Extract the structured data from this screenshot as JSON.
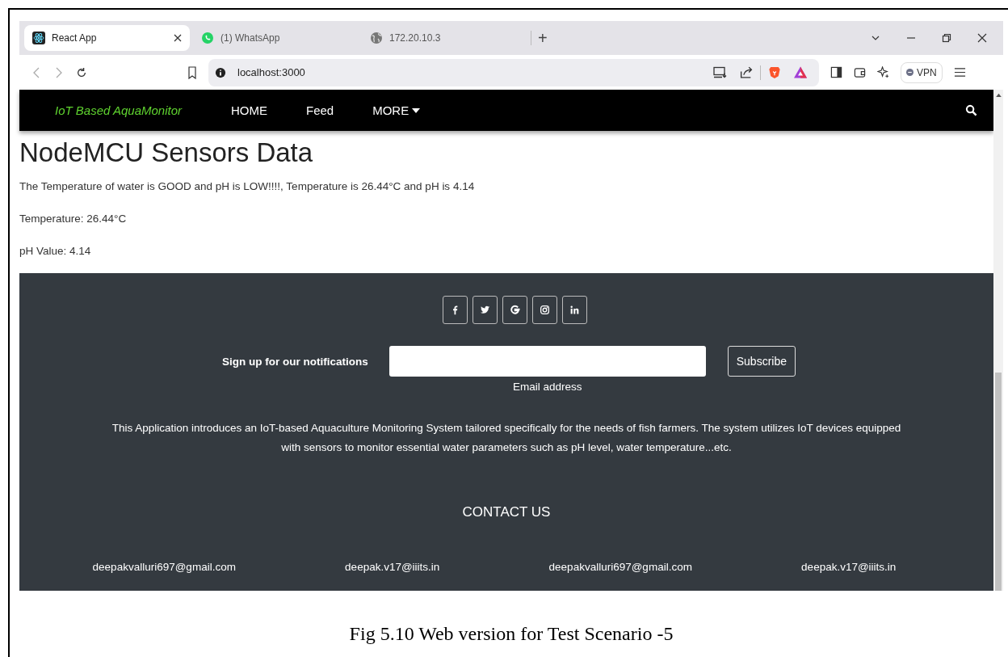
{
  "browser": {
    "tabs": [
      {
        "title": "React App",
        "kind": "react",
        "selected": true
      },
      {
        "title": "(1) WhatsApp",
        "kind": "whatsapp",
        "selected": false
      },
      {
        "title": "172.20.10.3",
        "kind": "globe",
        "selected": false
      }
    ],
    "new_tab": "+",
    "url": "localhost:3000",
    "vpn": "VPN"
  },
  "navbar": {
    "brand": "IoT Based AquaMonitor",
    "links": [
      {
        "label": "HOME",
        "dropdown": false
      },
      {
        "label": "Feed",
        "dropdown": false
      },
      {
        "label": "MORE",
        "dropdown": true
      }
    ]
  },
  "content": {
    "heading": "NodeMCU Sensors Data",
    "status": "The Temperature of water is GOOD and pH is LOW!!!!, Temperature is 26.44°C and pH is 4.14",
    "temperature": "Temperature: 26.44°C",
    "ph": "pH Value: 4.14"
  },
  "footer": {
    "social": [
      {
        "kind": "facebook"
      },
      {
        "kind": "twitter"
      },
      {
        "kind": "google"
      },
      {
        "kind": "instagram"
      },
      {
        "kind": "linkedin"
      }
    ],
    "signup_label": "Sign up for our notifications",
    "email_hint": "Email address",
    "subscribe": "Subscribe",
    "about": "This Application introduces an IoT-based Aquaculture Monitoring System tailored specifically for the needs of fish farmers. The system utilizes IoT devices equipped with sensors to monitor essential water parameters such as pH level, water temperature...etc.",
    "contact_title": "CONTACT US",
    "contacts": [
      "deepakvalluri697@gmail.com",
      "deepak.v17@iiits.in",
      "deepakvalluri697@gmail.com",
      "deepak.v17@iiits.in"
    ]
  },
  "caption": "Fig 5.10 Web version for Test Scenario -5"
}
